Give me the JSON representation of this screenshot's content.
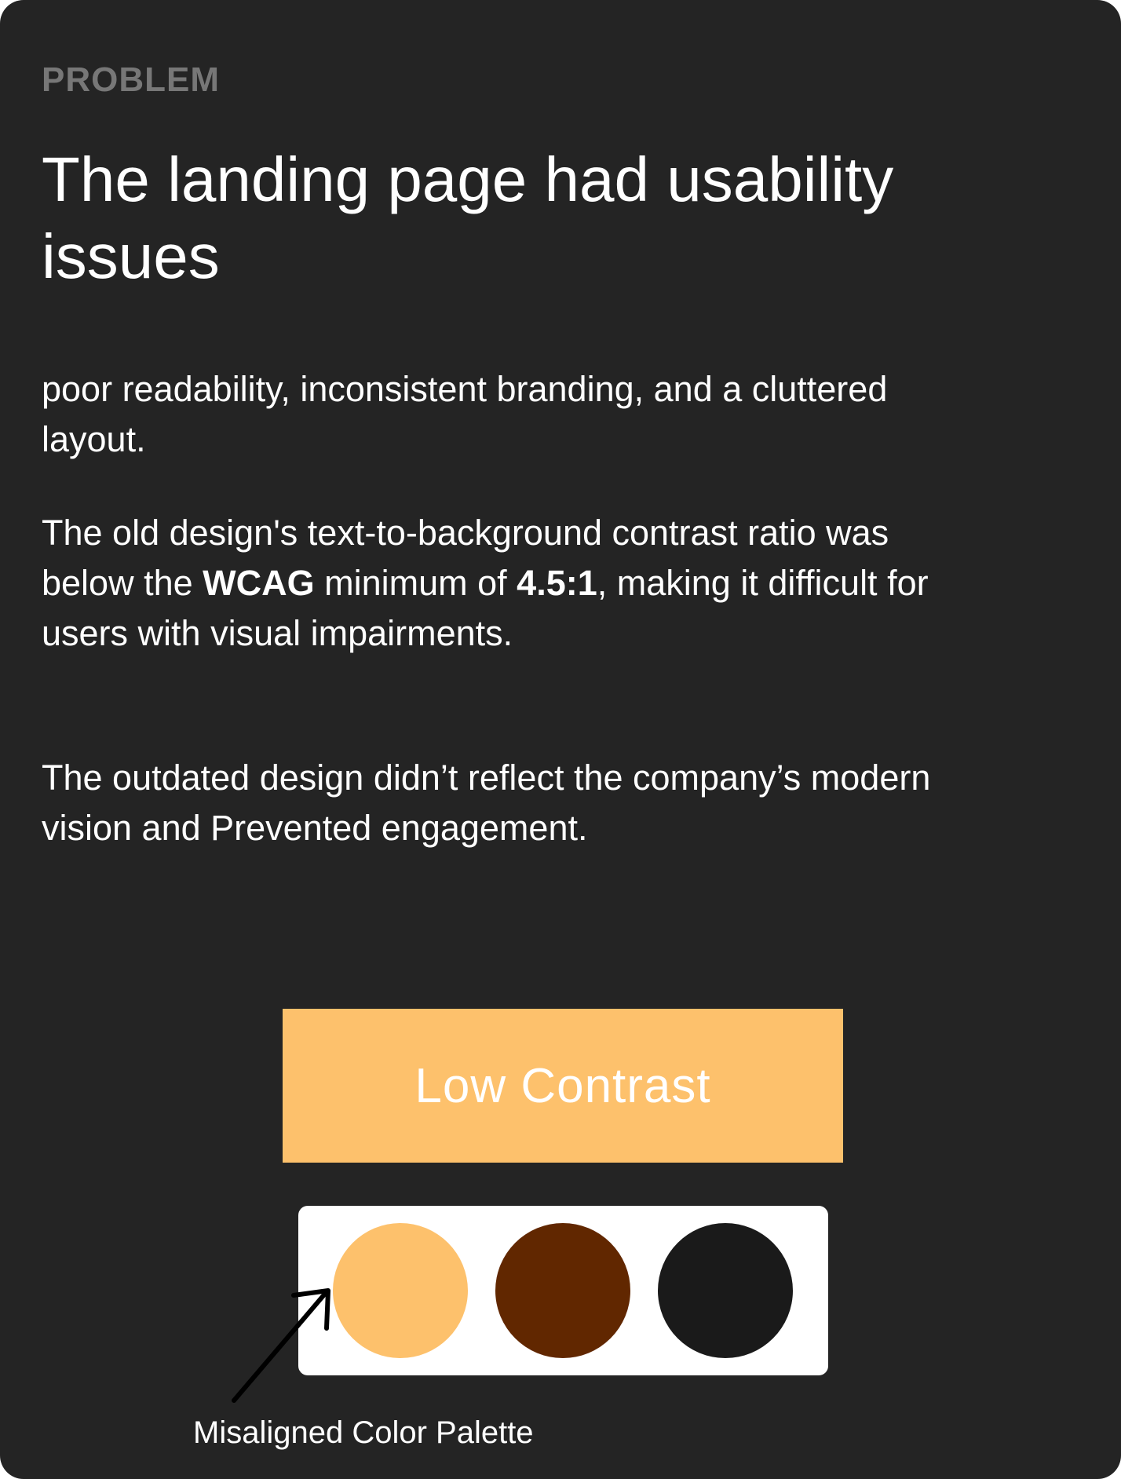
{
  "section": {
    "eyebrow": "PROBLEM",
    "title": "The landing page had usability issues"
  },
  "paragraphs": {
    "p1": "poor readability, inconsistent branding, and a cluttered layout.",
    "p2": {
      "part1": "The old design's text-to-background contrast ratio was below the ",
      "bold1": "WCAG",
      "part2": " minimum of ",
      "bold2": "4.5:1",
      "part3": ", making it difficult for users with visual impairments."
    },
    "p3": "The outdated design didn’t reflect the company’s modern vision and Prevented engagement."
  },
  "example": {
    "label": "Low Contrast",
    "background_color": "#fdc16c",
    "text_color": "#ffffff"
  },
  "palette": {
    "swatches": [
      {
        "color": "#fdc16c"
      },
      {
        "color": "#612700"
      },
      {
        "color": "#1a1a1a"
      }
    ],
    "caption": "Misaligned Color Palette",
    "arrow_icon": "arrow-up-right-icon"
  },
  "colors": {
    "card_background": "#242424",
    "eyebrow": "#777777",
    "text": "#ffffff"
  }
}
